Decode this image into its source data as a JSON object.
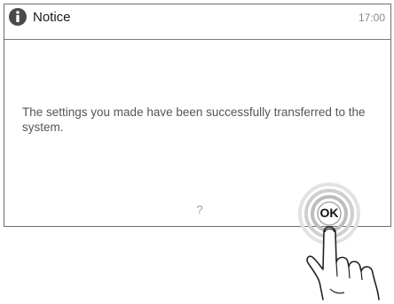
{
  "dialog": {
    "title": "Notice",
    "time": "17:00",
    "message": "The settings you made have been successfully transferred to the system.",
    "icon": "info-icon"
  },
  "footer": {
    "help_label": "?",
    "ok_label": "OK"
  },
  "colors": {
    "icon_fill": "#4a4a4a",
    "border": "#6e6e6e",
    "message_text": "#555555",
    "touch_ring": "#b8b8b8"
  }
}
